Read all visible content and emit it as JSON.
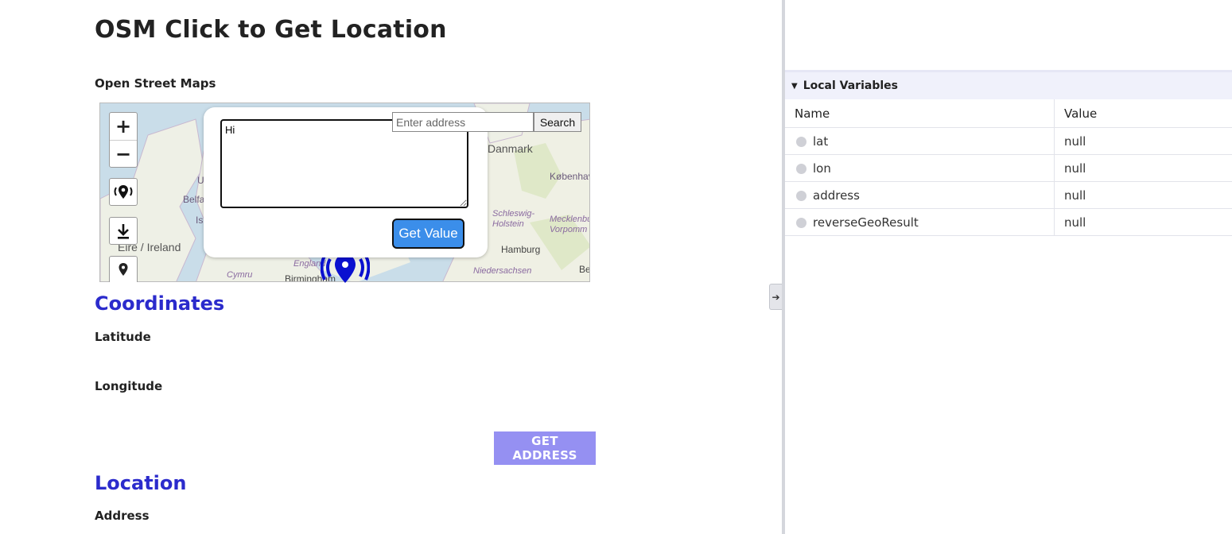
{
  "page": {
    "title": "OSM Click to Get Location",
    "map_section_label": "Open Street Maps",
    "coordinates_heading": "Coordinates",
    "latitude_label": "Latitude",
    "longitude_label": "Longitude",
    "get_address_label": "GET ADDRESS",
    "location_heading": "Location",
    "address_label": "Address"
  },
  "map": {
    "zoom_in": "+",
    "zoom_out": "−",
    "popup": {
      "textarea_value": "Hi",
      "get_value_label": "Get Value"
    },
    "search": {
      "placeholder": "Enter address",
      "button_label": "Search"
    },
    "place_labels": [
      "Danmark",
      "København",
      "Belfa",
      "U",
      "Is",
      "Éire / Ireland",
      "Schleswig-Holstein",
      "Mecklenbu Vorpomm",
      "Hamburg",
      "England",
      "Cymru",
      "Birmingham",
      "Niedersachsen",
      "Be"
    ]
  },
  "debug_panel": {
    "section_title": "Local Variables",
    "columns": [
      "Name",
      "Value"
    ],
    "variables": [
      {
        "name": "lat",
        "value": "null"
      },
      {
        "name": "lon",
        "value": "null"
      },
      {
        "name": "address",
        "value": "null"
      },
      {
        "name": "reverseGeoResult",
        "value": "null"
      }
    ]
  },
  "colors": {
    "heading_blue": "#2b2bcc",
    "get_address_bg": "#9590f2",
    "get_value_bg": "#3b8eea",
    "marker": "#0a10d0"
  }
}
